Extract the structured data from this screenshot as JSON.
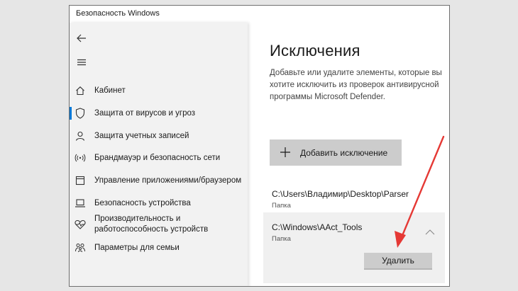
{
  "window": {
    "title": "Безопасность Windows"
  },
  "sidebar": {
    "items": [
      {
        "label": "Кабинет",
        "icon": "home-icon"
      },
      {
        "label": "Защита от вирусов и угроз",
        "icon": "shield-icon",
        "active": true
      },
      {
        "label": "Защита учетных записей",
        "icon": "person-icon"
      },
      {
        "label": "Брандмауэр и безопасность сети",
        "icon": "wifi-antenna-icon"
      },
      {
        "label": "Управление приложениями/браузером",
        "icon": "app-window-icon"
      },
      {
        "label": "Безопасность устройства",
        "icon": "laptop-icon"
      },
      {
        "label": "Производительность и работоспособность устройств",
        "icon": "heart-icon"
      },
      {
        "label": "Параметры для семьи",
        "icon": "family-icon"
      }
    ]
  },
  "main": {
    "heading": "Исключения",
    "description": "Добавьте или удалите элементы, которые вы хотите исключить из проверок антивирусной программы Microsoft Defender.",
    "add_button_label": "Добавить исключение",
    "exclusions": [
      {
        "path": "C:\\Users\\Владимир\\Desktop\\Parser",
        "type": "Папка"
      },
      {
        "path": "C:\\Windows\\AAct_Tools",
        "type": "Папка",
        "expanded": true
      }
    ],
    "remove_button_label": "Удалить"
  },
  "colors": {
    "accent": "#0078d7",
    "arrow": "#e53935"
  }
}
